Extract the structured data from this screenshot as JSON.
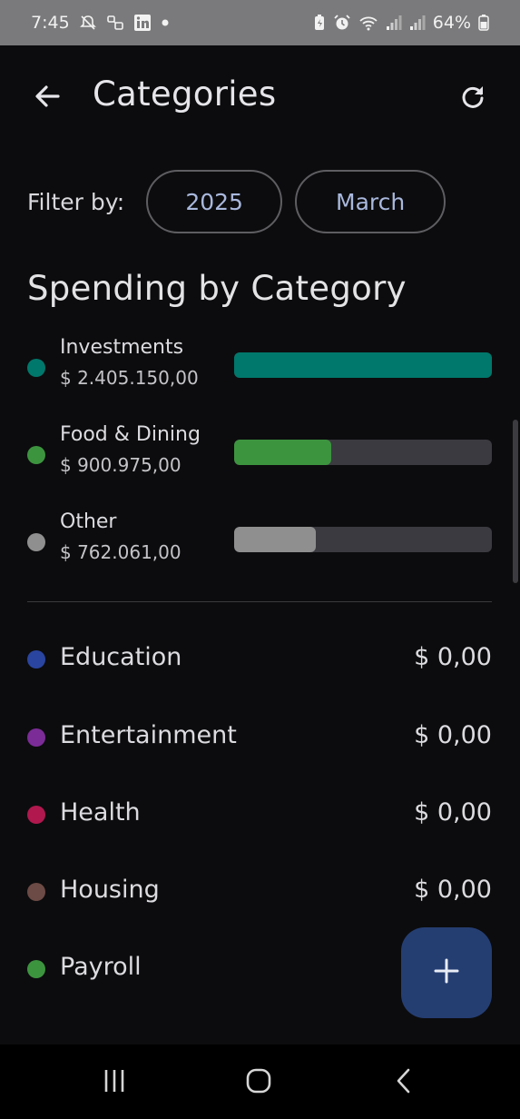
{
  "status_bar": {
    "time": "7:45",
    "battery": "64%",
    "left_icons": [
      "notifications-off-icon",
      "link-icon",
      "linkedin-icon",
      "dot-icon"
    ],
    "right_icons": [
      "battery-saver-icon",
      "alarm-icon",
      "wifi-icon",
      "signal-icon",
      "signal-icon",
      "battery-icon"
    ]
  },
  "app_bar": {
    "title": "Categories",
    "back_icon": "back-arrow-icon",
    "refresh_icon": "refresh-icon"
  },
  "filter": {
    "label": "Filter by:",
    "year": "2025",
    "month": "March"
  },
  "section_title": "Spending by Category",
  "spending": [
    {
      "name": "Investments",
      "amount": "$ 2.405.150,00",
      "color": "#00786b",
      "fraction": 1.0
    },
    {
      "name": "Food & Dining",
      "amount": "$ 900.975,00",
      "color": "#3d943f",
      "fraction": 0.375
    },
    {
      "name": "Other",
      "amount": "$ 762.061,00",
      "color": "#8f8f8f",
      "fraction": 0.317
    }
  ],
  "categories": [
    {
      "name": "Education",
      "amount": "$ 0,00",
      "color": "#2a45a0"
    },
    {
      "name": "Entertainment",
      "amount": "$ 0,00",
      "color": "#7b2c96"
    },
    {
      "name": "Health",
      "amount": "$ 0,00",
      "color": "#b0184e"
    },
    {
      "name": "Housing",
      "amount": "$ 0,00",
      "color": "#6c4a45"
    },
    {
      "name": "Payroll",
      "amount": "",
      "color": "#3d943f"
    }
  ],
  "fab": {
    "icon": "plus-icon",
    "color": "#253e72"
  },
  "nav_bar": {
    "icons": [
      "recent-apps-icon",
      "home-icon",
      "back-icon"
    ]
  }
}
